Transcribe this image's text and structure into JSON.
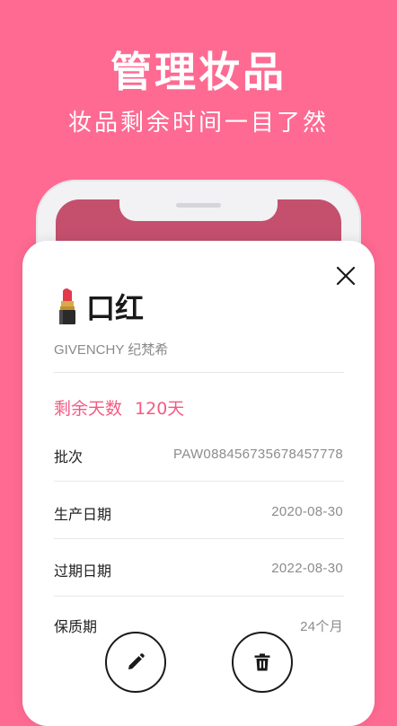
{
  "header": {
    "title": "管理妆品",
    "subtitle": "妆品剩余时间一目了然"
  },
  "product": {
    "icon": "lipstick-icon",
    "name": "口红",
    "brand": "GIVENCHY 纪梵希",
    "remaining_label": "剩余天数",
    "remaining_value": "120天"
  },
  "details": [
    {
      "label": "批次",
      "value": "PAW088456735678457778"
    },
    {
      "label": "生产日期",
      "value": "2020-08-30"
    },
    {
      "label": "过期日期",
      "value": "2022-08-30"
    },
    {
      "label": "保质期",
      "value": "24个月"
    }
  ],
  "actions": {
    "close_icon": "close-icon",
    "edit_icon": "pencil-icon",
    "delete_icon": "trash-icon"
  },
  "colors": {
    "background": "#FE6A92",
    "accent": "#F45B83"
  }
}
